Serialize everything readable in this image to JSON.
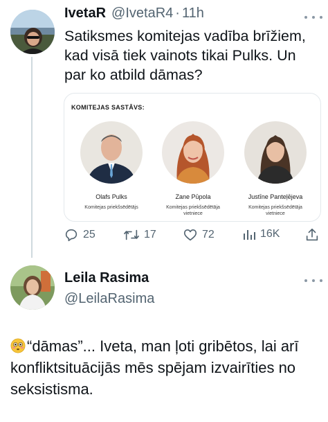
{
  "tweet1": {
    "author_name": "IvetaR",
    "handle": "@IvetaR4",
    "separator": "·",
    "time": "11h",
    "text": "Satiksmes komitejas vadība brīžiem, kad visā tiek vainots tikai Pulks. Un par ko atbild dāmas?",
    "card": {
      "title": "KOMITEJAS SASTĀVS:",
      "members": [
        {
          "name": "Olafs Pulks",
          "role": "Komitejas priekšsēdētājs"
        },
        {
          "name": "Zane Pūpola",
          "role": "Komitejas priekšsēdētāja vietniece"
        },
        {
          "name": "Justīne Panteļējeva",
          "role": "Komitejas priekšsēdētāja vietniece"
        }
      ]
    },
    "actions": {
      "replies": "25",
      "retweets": "17",
      "likes": "72",
      "views": "16K"
    }
  },
  "tweet2": {
    "author_name": "Leila Rasima",
    "handle": "@LeilaRasima",
    "text": "“dāmas”... Iveta, man ļoti gribētos, lai arī konfliktsituācijās mēs spējam izvairīties no seksistisma."
  },
  "colors": {
    "text": "#0f1419",
    "secondary": "#536471",
    "border": "#e3e8ec",
    "thread_line": "#cfd9de"
  }
}
